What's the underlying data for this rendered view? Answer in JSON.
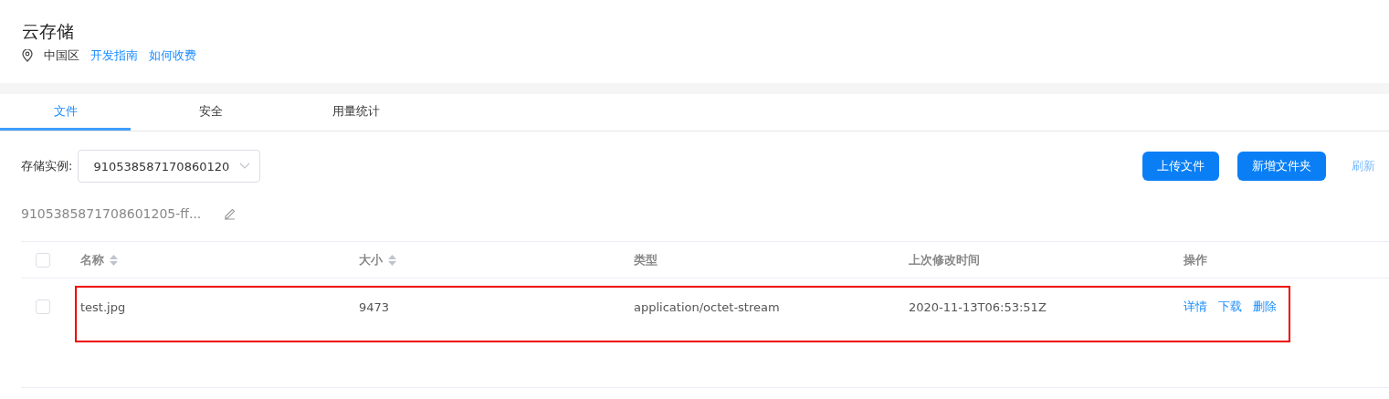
{
  "header": {
    "title": "云存储",
    "region": "中国区",
    "links": [
      "开发指南",
      "如何收费"
    ]
  },
  "tabs": [
    {
      "label": "文件",
      "selected": true
    },
    {
      "label": "安全",
      "selected": false
    },
    {
      "label": "用量统计",
      "selected": false
    }
  ],
  "toolbar": {
    "instance_label": "存储实例:",
    "instance_value": "910538587170860120",
    "buttons": [
      "上传文件",
      "新增文件夹"
    ],
    "refresh": "刷新"
  },
  "path": "9105385871708601205-ff...",
  "table": {
    "select_all_checked": false,
    "columns": [
      {
        "label": "名称",
        "sortable": true
      },
      {
        "label": "大小",
        "sortable": true
      },
      {
        "label": "类型",
        "sortable": false
      },
      {
        "label": "上次修改时间",
        "sortable": false
      },
      {
        "label": "操作",
        "sortable": false
      }
    ],
    "rows": [
      {
        "checked": false,
        "highlighted": true,
        "cells": [
          "test.jpg",
          "9473",
          "application/octet-stream",
          "2020-11-13T06:53:51Z"
        ],
        "actions": [
          "详情",
          "下载",
          "删除"
        ]
      }
    ]
  }
}
